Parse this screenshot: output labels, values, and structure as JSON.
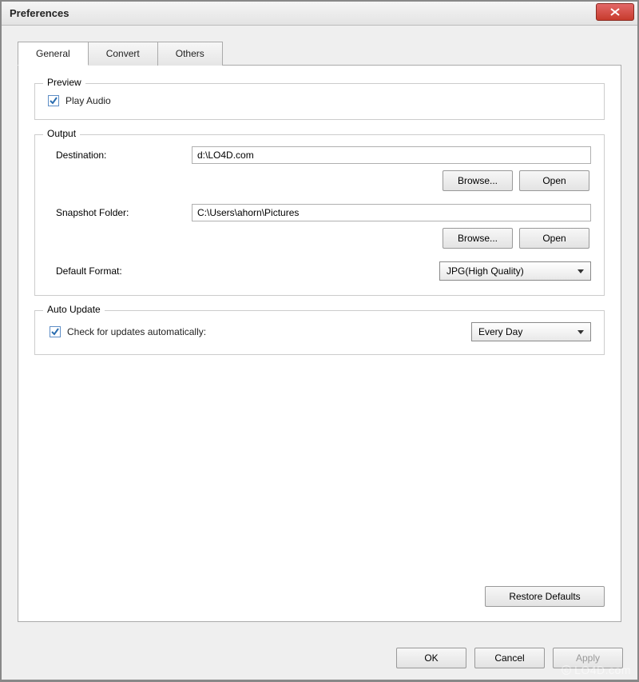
{
  "window": {
    "title": "Preferences"
  },
  "tabs": {
    "general": "General",
    "convert": "Convert",
    "others": "Others"
  },
  "preview": {
    "legend": "Preview",
    "play_audio_label": "Play Audio"
  },
  "output": {
    "legend": "Output",
    "destination_label": "Destination:",
    "destination_value": "d:\\LO4D.com",
    "browse_label": "Browse...",
    "open_label": "Open",
    "snapshot_label": "Snapshot Folder:",
    "snapshot_value": "C:\\Users\\ahorn\\Pictures",
    "default_format_label": "Default Format:",
    "default_format_value": "JPG(High Quality)"
  },
  "autoupdate": {
    "legend": "Auto Update",
    "check_label": "Check for updates automatically:",
    "interval_value": "Every Day"
  },
  "buttons": {
    "restore_defaults": "Restore Defaults",
    "ok": "OK",
    "cancel": "Cancel",
    "apply": "Apply"
  },
  "watermark": "LO4D.com"
}
